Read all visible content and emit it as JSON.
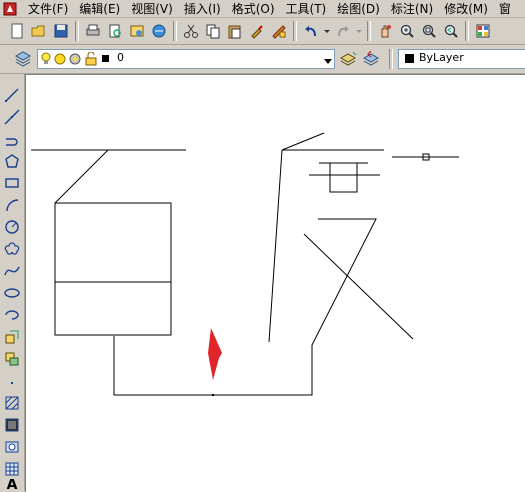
{
  "menubar": {
    "items": [
      "文件(F)",
      "编辑(E)",
      "视图(V)",
      "插入(I)",
      "格式(O)",
      "工具(T)",
      "绘图(D)",
      "标注(N)",
      "修改(M)",
      "窗"
    ]
  },
  "toolbar": {
    "icons": [
      "new-file-icon",
      "open-icon",
      "save-icon",
      "print-icon",
      "print-preview-icon",
      "publish-icon",
      "plot-icon",
      "cut-icon",
      "copy-icon",
      "paste-icon",
      "match-properties-icon",
      "block-editor-icon",
      "undo-icon",
      "redo-icon",
      "pan-icon",
      "zoom-realtime-icon",
      "zoom-window-icon",
      "zoom-previous-icon",
      "properties-icon"
    ]
  },
  "layers": {
    "current_layer": "0",
    "color_combo_value": "ByLayer"
  },
  "draw_tools": [
    "line-icon",
    "construction-line-icon",
    "polyline-icon",
    "polygon-icon",
    "rectangle-icon",
    "arc-icon",
    "circle-icon",
    "revision-cloud-icon",
    "spline-icon",
    "ellipse-icon",
    "ellipse-arc-icon",
    "insert-block-icon",
    "make-block-icon",
    "point-icon",
    "hatch-icon",
    "gradient-icon",
    "region-icon",
    "table-icon",
    "multiline-text-icon"
  ],
  "drawing": {
    "text_glyph": "A",
    "accent_arrow_color": "#e0262b"
  }
}
